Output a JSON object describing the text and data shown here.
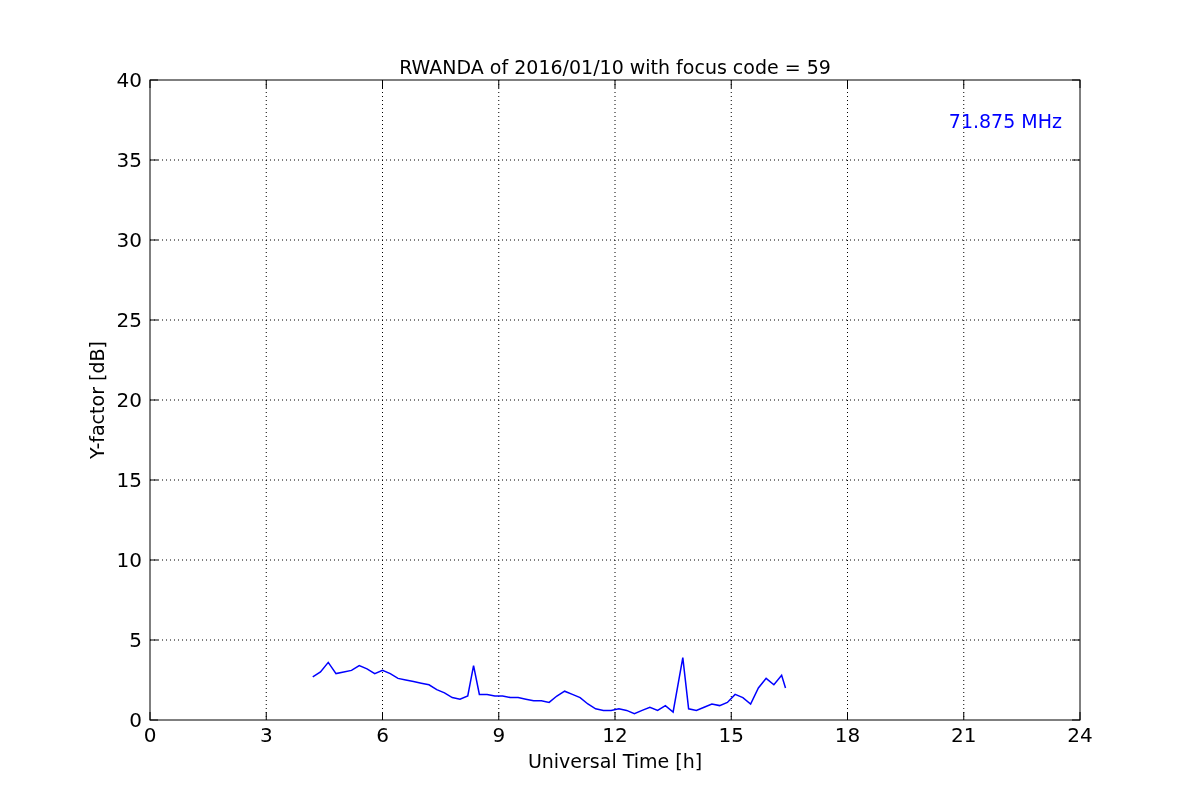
{
  "figure": {
    "chart_data": {
      "type": "line",
      "title": "RWANDA of 2016/01/10 with focus code = 59",
      "xlabel": "Universal Time [h]",
      "ylabel": "Y-factor [dB]",
      "x": [
        4.2,
        4.4,
        4.6,
        4.8,
        5.0,
        5.2,
        5.4,
        5.6,
        5.8,
        6.0,
        6.2,
        6.4,
        6.6,
        6.8,
        7.0,
        7.2,
        7.4,
        7.6,
        7.8,
        8.0,
        8.2,
        8.35,
        8.5,
        8.7,
        8.9,
        9.1,
        9.3,
        9.5,
        9.7,
        9.9,
        10.1,
        10.3,
        10.5,
        10.7,
        10.9,
        11.1,
        11.3,
        11.5,
        11.7,
        11.9,
        12.1,
        12.3,
        12.5,
        12.7,
        12.9,
        13.1,
        13.3,
        13.5,
        13.75,
        13.9,
        14.1,
        14.3,
        14.5,
        14.7,
        14.9,
        15.1,
        15.3,
        15.5,
        15.7,
        15.9,
        16.1,
        16.3,
        16.4
      ],
      "series": [
        {
          "name": "71.875 MHz",
          "color": "#0000ff",
          "values": [
            2.7,
            3.0,
            3.6,
            2.9,
            3.0,
            3.1,
            3.4,
            3.2,
            2.9,
            3.1,
            2.9,
            2.6,
            2.5,
            2.4,
            2.3,
            2.2,
            1.9,
            1.7,
            1.4,
            1.3,
            1.5,
            3.4,
            1.6,
            1.6,
            1.5,
            1.5,
            1.4,
            1.4,
            1.3,
            1.2,
            1.2,
            1.1,
            1.5,
            1.8,
            1.6,
            1.4,
            1.0,
            0.7,
            0.6,
            0.6,
            0.7,
            0.6,
            0.4,
            0.6,
            0.8,
            0.6,
            0.9,
            0.5,
            3.9,
            0.7,
            0.6,
            0.8,
            1.0,
            0.9,
            1.1,
            1.6,
            1.4,
            1.0,
            2.0,
            2.6,
            2.2,
            2.8,
            2.0
          ]
        }
      ],
      "xlim": [
        0,
        24
      ],
      "ylim": [
        0,
        40
      ],
      "xticks": [
        0,
        3,
        6,
        9,
        12,
        15,
        18,
        21,
        24
      ],
      "yticks": [
        0,
        5,
        10,
        15,
        20,
        25,
        30,
        35,
        40
      ],
      "grid": true
    }
  }
}
